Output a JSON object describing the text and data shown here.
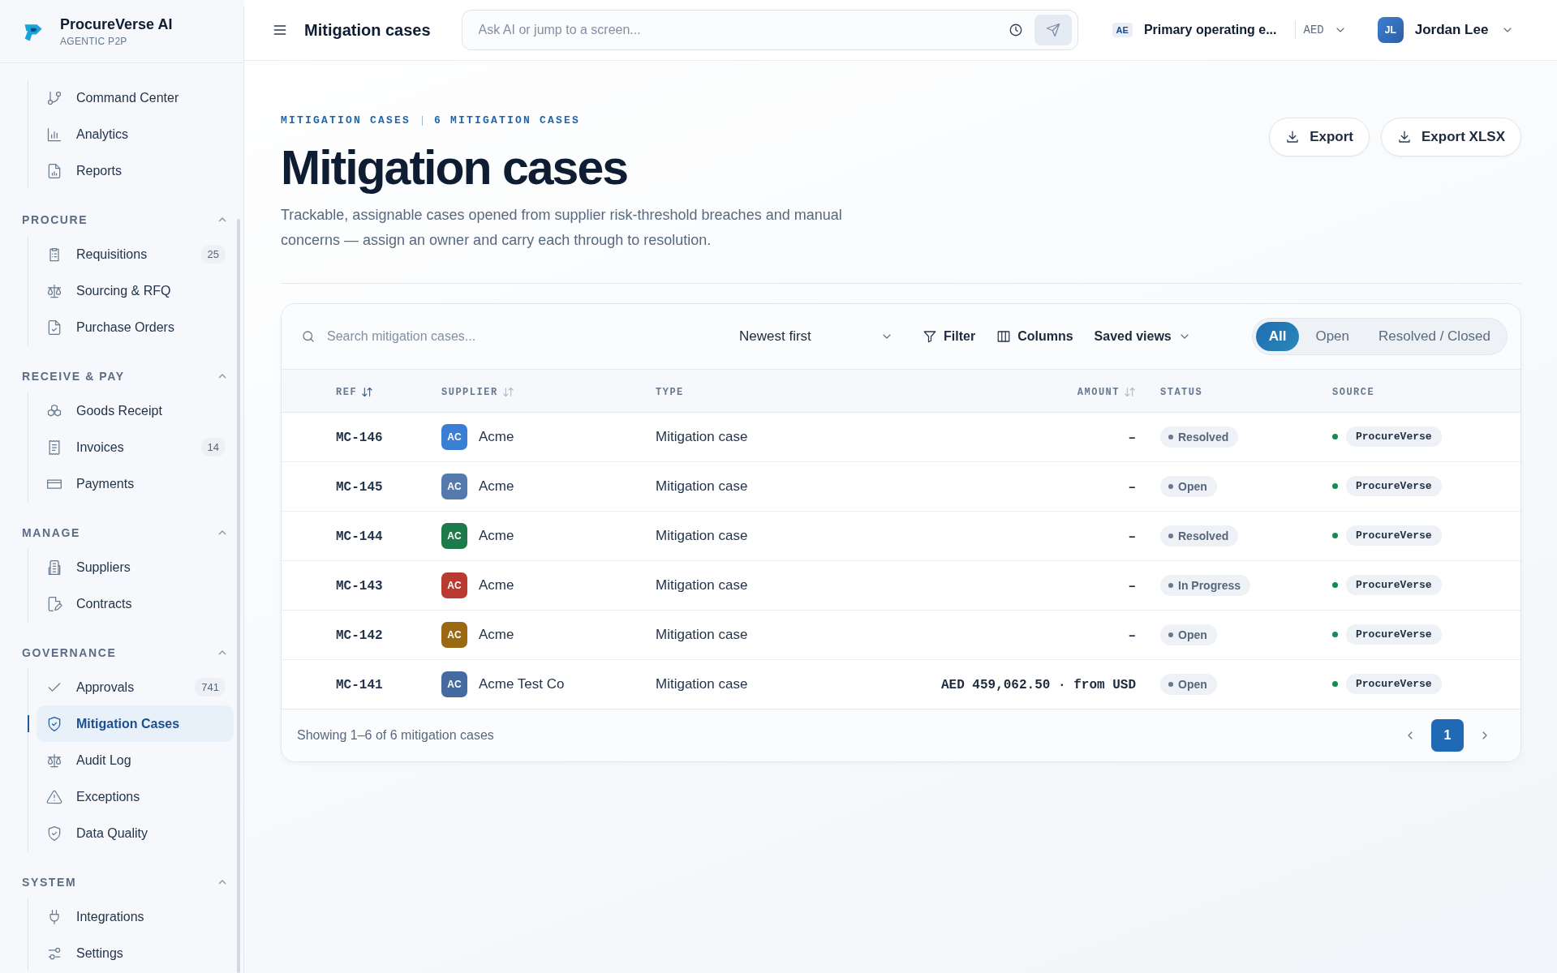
{
  "brand": {
    "name": "ProcureVerse AI",
    "tagline": "AGENTIC P2P"
  },
  "sidebar": {
    "groups": [
      {
        "items": [
          {
            "label": "Command Center",
            "selected": false
          },
          {
            "label": "Analytics",
            "selected": false
          },
          {
            "label": "Reports",
            "selected": false
          }
        ]
      },
      {
        "title": "PROCURE",
        "expanded": true,
        "items": [
          {
            "label": "Requisitions",
            "badge": "25",
            "selected": false
          },
          {
            "label": "Sourcing & RFQ",
            "selected": false
          },
          {
            "label": "Purchase Orders",
            "selected": false
          }
        ]
      },
      {
        "title": "RECEIVE & PAY",
        "expanded": true,
        "items": [
          {
            "label": "Goods Receipt",
            "selected": false
          },
          {
            "label": "Invoices",
            "badge": "14",
            "selected": false
          },
          {
            "label": "Payments",
            "selected": false
          }
        ]
      },
      {
        "title": "MANAGE",
        "expanded": true,
        "items": [
          {
            "label": "Suppliers",
            "selected": false
          },
          {
            "label": "Contracts",
            "selected": false
          }
        ]
      },
      {
        "title": "GOVERNANCE",
        "expanded": true,
        "items": [
          {
            "label": "Approvals",
            "badge": "741",
            "selected": false
          },
          {
            "label": "Mitigation Cases",
            "selected": true
          },
          {
            "label": "Audit Log",
            "selected": false
          },
          {
            "label": "Exceptions",
            "selected": false
          },
          {
            "label": "Data Quality",
            "selected": false
          }
        ]
      },
      {
        "title": "SYSTEM",
        "expanded": true,
        "items": [
          {
            "label": "Integrations",
            "selected": false
          },
          {
            "label": "Settings",
            "selected": false
          }
        ]
      }
    ]
  },
  "topbar": {
    "title": "Mitigation cases",
    "search": {
      "placeholder": "Ask AI or jump to a screen..."
    },
    "entity_code": "AE",
    "entity": "Primary operating e...",
    "currency": "AED",
    "user_initials": "JL",
    "user": "Jordan Lee"
  },
  "header": {
    "breadcrumb": [
      "MITIGATION CASES",
      "6 MITIGATION CASES"
    ],
    "title": "Mitigation cases",
    "description": "Trackable, assignable cases opened from supplier risk-threshold breaches and manual concerns — assign an owner and carry each through to resolution.",
    "buttons": [
      "Export",
      "Export XLSX"
    ]
  },
  "table": {
    "search": {
      "placeholder": "Search mitigation cases..."
    },
    "sort": "Newest first",
    "actions": [
      "Filter",
      "Columns",
      "Saved views"
    ],
    "segments": [
      {
        "label": "All",
        "selected": true
      },
      {
        "label": "Open",
        "selected": false
      },
      {
        "label": "Resolved / Closed",
        "selected": false
      }
    ],
    "columns": [
      {
        "label": "REF",
        "sortable": true,
        "sorted": true
      },
      {
        "label": "SUPPLIER",
        "sortable": true,
        "sorted": false
      },
      {
        "label": "TYPE"
      },
      {
        "label": "AMOUNT",
        "sortable": true,
        "sorted": false
      },
      {
        "label": "STATUS"
      },
      {
        "label": "SOURCE"
      }
    ],
    "rows": [
      {
        "ref": "MC-146",
        "initials": "AC",
        "color": "#3b7fd4",
        "supplier": "Acme",
        "type": "Mitigation case",
        "amount": "–",
        "status": "Resolved",
        "source": "ProcureVerse"
      },
      {
        "ref": "MC-145",
        "initials": "AC",
        "color": "#5479ad",
        "supplier": "Acme",
        "type": "Mitigation case",
        "amount": "–",
        "status": "Open",
        "source": "ProcureVerse"
      },
      {
        "ref": "MC-144",
        "initials": "AC",
        "color": "#1d7a4b",
        "supplier": "Acme",
        "type": "Mitigation case",
        "amount": "–",
        "status": "Resolved",
        "source": "ProcureVerse"
      },
      {
        "ref": "MC-143",
        "initials": "AC",
        "color": "#b83a30",
        "supplier": "Acme",
        "type": "Mitigation case",
        "amount": "–",
        "status": "In Progress",
        "source": "ProcureVerse"
      },
      {
        "ref": "MC-142",
        "initials": "AC",
        "color": "#9a6912",
        "supplier": "Acme",
        "type": "Mitigation case",
        "amount": "–",
        "status": "Open",
        "source": "ProcureVerse"
      },
      {
        "ref": "MC-141",
        "initials": "AC",
        "color": "#456a9f",
        "supplier": "Acme Test Co",
        "type": "Mitigation case",
        "amount": "AED 459,062.50 · from USD",
        "status": "Open",
        "source": "ProcureVerse"
      }
    ],
    "footer": "Showing 1–6 of 6 mitigation cases",
    "pages": [
      {
        "label": "1",
        "selected": true
      }
    ]
  }
}
